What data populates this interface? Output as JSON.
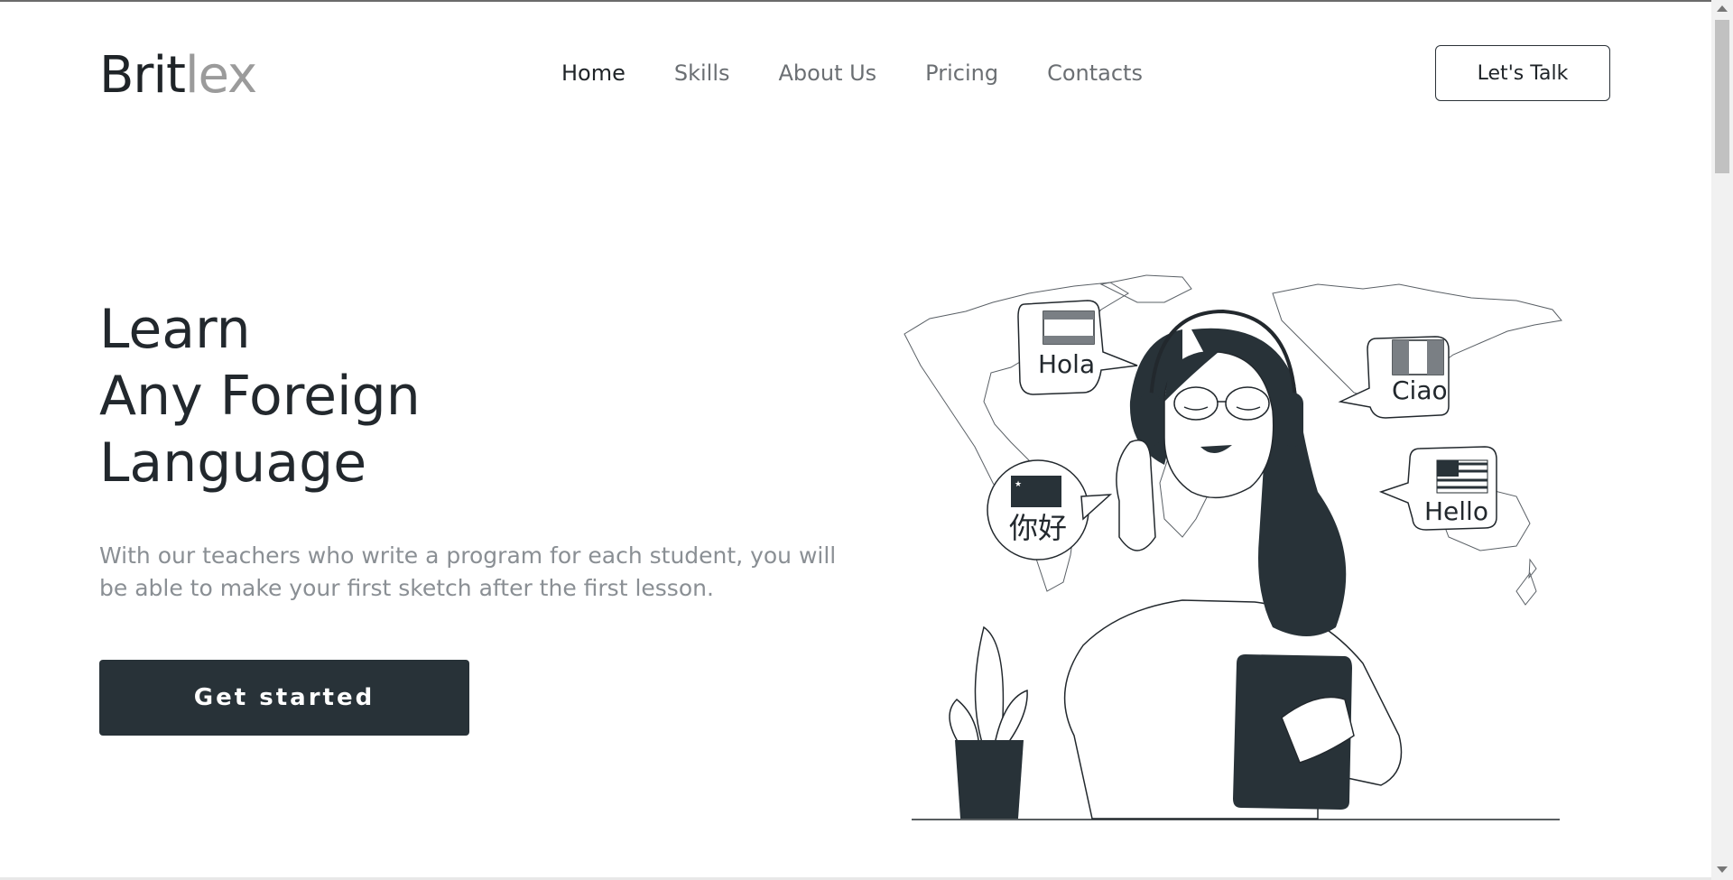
{
  "brand": {
    "part1": "Brit",
    "part2": "lex"
  },
  "nav": {
    "items": [
      {
        "label": "Home",
        "active": true
      },
      {
        "label": "Skills"
      },
      {
        "label": "About Us"
      },
      {
        "label": "Pricing"
      },
      {
        "label": "Contacts"
      }
    ]
  },
  "header": {
    "cta_label": "Let's Talk"
  },
  "hero": {
    "title_lines": [
      "Learn",
      "Any Foreign",
      "Language"
    ],
    "subtitle": "With our teachers who write a program for each student, you will be able to make your first sketch after the first lesson.",
    "cta_label": "Get started"
  },
  "illustration": {
    "bubbles": [
      "Hola",
      "Ciao",
      "你好",
      "Hello"
    ]
  },
  "colors": {
    "dark": "#283238",
    "muted": "#8a8f94",
    "logo_light": "#9b9b9b"
  }
}
